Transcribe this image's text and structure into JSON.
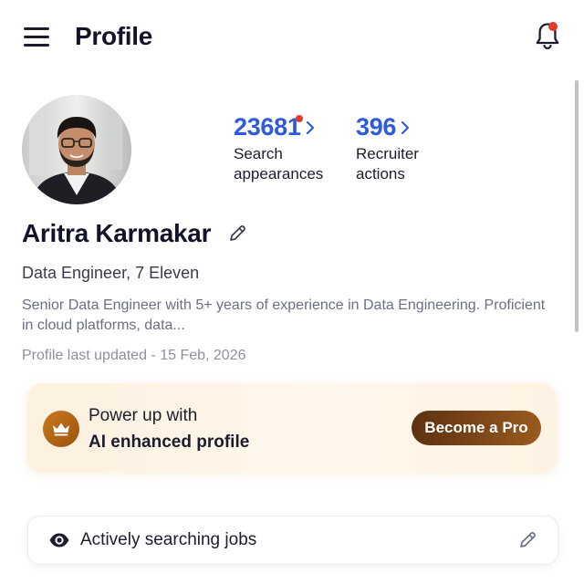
{
  "header": {
    "title": "Profile",
    "menu_icon": "hamburger-menu-icon",
    "notification_icon": "bell-icon",
    "notification_dot_color": "#e23a2b"
  },
  "profile": {
    "avatar_icon": "profile-photo",
    "name": "Aritra Karmakar",
    "headline": "Data Engineer, 7 Eleven",
    "summary": "Senior Data Engineer with 5+ years of experience in Data Engineering. Proficient in cloud platforms, data...",
    "last_updated": "Profile last updated - 15 Feb, 2026"
  },
  "stats": {
    "search_appearances": {
      "value": "23681",
      "label": "Search\nappearances",
      "has_new_dot": true
    },
    "recruiter_actions": {
      "value": "396",
      "label": "Recruiter\nactions"
    },
    "value_color": "#2e5bdb"
  },
  "pro_card": {
    "line1": "Power up with",
    "line2": "AI enhanced profile",
    "button_label": "Become a Pro",
    "icon": "crown-icon"
  },
  "job_status": {
    "label": "Actively searching jobs",
    "icon": "eye-icon",
    "edit_icon": "pencil-icon"
  }
}
